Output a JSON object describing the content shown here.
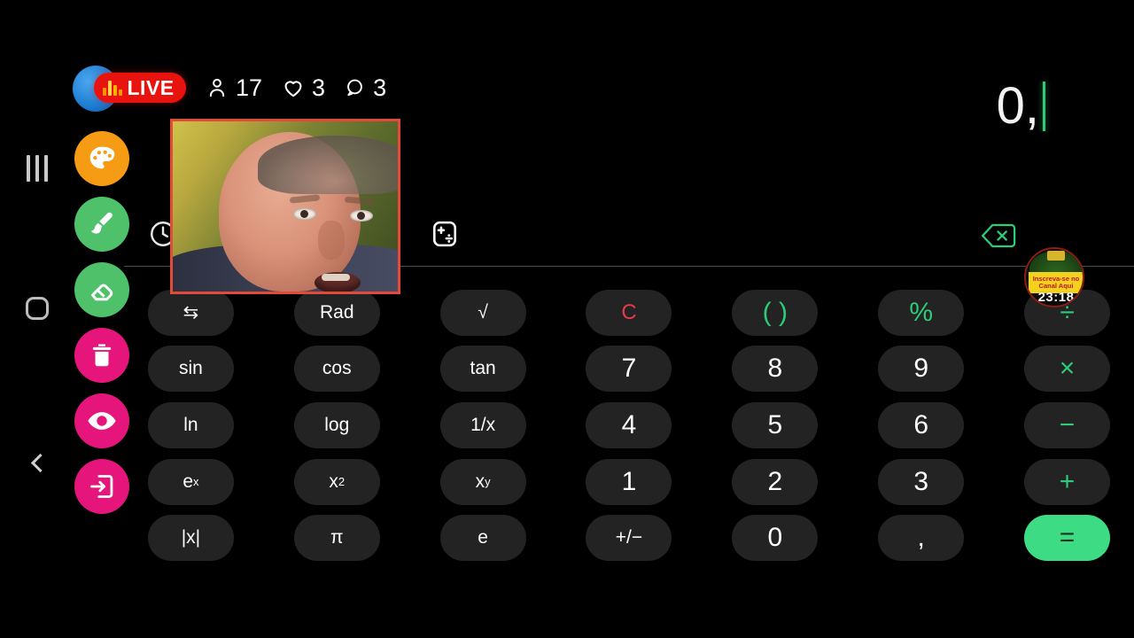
{
  "system_nav": {
    "recents": "recents",
    "home": "home",
    "back": "back"
  },
  "live_overlay": {
    "badge_label": "LIVE",
    "stats": [
      {
        "icon": "person-icon",
        "value": "17"
      },
      {
        "icon": "heart-icon",
        "value": "3"
      },
      {
        "icon": "comment-icon",
        "value": "3"
      }
    ],
    "colors": {
      "live_red": "#e8130f",
      "ring_blue": "#1b79d0",
      "bars_orange": "#ffb300"
    }
  },
  "calculator": {
    "display": {
      "value": "0,",
      "caret_color": "#2ecc78"
    },
    "toolbar": [
      {
        "name": "history-icon",
        "label": "history"
      },
      {
        "name": "calculator-mode-icon",
        "label": "mode"
      },
      {
        "name": "backspace-icon",
        "label": "backspace"
      }
    ],
    "angle_mode": "Rad",
    "keys": [
      {
        "label": "⇆",
        "name": "toggle-layout-key",
        "style": "fn"
      },
      {
        "label": "Rad",
        "name": "angle-mode-key",
        "style": "fn"
      },
      {
        "label": "√",
        "name": "sqrt-key",
        "style": "fn"
      },
      {
        "label": "C",
        "name": "clear-key",
        "style": "clear"
      },
      {
        "label": "( )",
        "name": "parentheses-key",
        "style": "op"
      },
      {
        "label": "%",
        "name": "percent-key",
        "style": "op"
      },
      {
        "label": "÷",
        "name": "divide-key",
        "style": "op"
      },
      {
        "label": "sin",
        "name": "sin-key",
        "style": "fn"
      },
      {
        "label": "cos",
        "name": "cos-key",
        "style": "fn"
      },
      {
        "label": "tan",
        "name": "tan-key",
        "style": "fn"
      },
      {
        "label": "7",
        "name": "digit-7-key",
        "style": "num"
      },
      {
        "label": "8",
        "name": "digit-8-key",
        "style": "num"
      },
      {
        "label": "9",
        "name": "digit-9-key",
        "style": "num"
      },
      {
        "label": "×",
        "name": "multiply-key",
        "style": "op"
      },
      {
        "label": "ln",
        "name": "ln-key",
        "style": "fn"
      },
      {
        "label": "log",
        "name": "log-key",
        "style": "fn"
      },
      {
        "label": "1/x",
        "name": "reciprocal-key",
        "style": "fn"
      },
      {
        "label": "4",
        "name": "digit-4-key",
        "style": "num"
      },
      {
        "label": "5",
        "name": "digit-5-key",
        "style": "num"
      },
      {
        "label": "6",
        "name": "digit-6-key",
        "style": "num"
      },
      {
        "label": "−",
        "name": "minus-key",
        "style": "op"
      },
      {
        "label": "e^x",
        "name": "exp-key",
        "style": "fn",
        "sup": [
          "e",
          "x"
        ]
      },
      {
        "label": "x^2",
        "name": "square-key",
        "style": "fn",
        "sup": [
          "x",
          "2"
        ]
      },
      {
        "label": "x^y",
        "name": "power-key",
        "style": "fn",
        "sup": [
          "x",
          "y"
        ]
      },
      {
        "label": "1",
        "name": "digit-1-key",
        "style": "num"
      },
      {
        "label": "2",
        "name": "digit-2-key",
        "style": "num"
      },
      {
        "label": "3",
        "name": "digit-3-key",
        "style": "num"
      },
      {
        "label": "+",
        "name": "plus-key",
        "style": "op"
      },
      {
        "label": "|x|",
        "name": "absolute-key",
        "style": "fn"
      },
      {
        "label": "π",
        "name": "pi-key",
        "style": "fn"
      },
      {
        "label": "e",
        "name": "euler-key",
        "style": "fn"
      },
      {
        "label": "+/−",
        "name": "sign-key",
        "style": "fn"
      },
      {
        "label": "0",
        "name": "digit-0-key",
        "style": "num"
      },
      {
        "label": ",",
        "name": "decimal-key",
        "style": "num"
      },
      {
        "label": "=",
        "name": "equals-key",
        "style": "equals"
      }
    ],
    "colors": {
      "key_bg": "#232323",
      "operator_green": "#2ecc78",
      "equals_green": "#3ddc84",
      "clear_red": "#e8394f"
    }
  },
  "tools": [
    {
      "name": "palette-tool",
      "icon": "palette-icon",
      "color": "#f59b14"
    },
    {
      "name": "brush-tool",
      "icon": "brush-icon",
      "color": "#4ec16a"
    },
    {
      "name": "eraser-tool",
      "icon": "eraser-icon",
      "color": "#4ec16a"
    },
    {
      "name": "delete-tool",
      "icon": "trash-icon",
      "color": "#e5157c"
    },
    {
      "name": "visibility-tool",
      "icon": "eye-icon",
      "color": "#e5157c"
    },
    {
      "name": "exit-tool",
      "icon": "exit-icon",
      "color": "#e5157c"
    }
  ],
  "webcam": {
    "name": "webcam-pip",
    "border_color": "#e24a3a"
  },
  "watermark": {
    "line1": "Inscreva-se no",
    "line2": "Canal Aqui",
    "time": "23:18"
  }
}
